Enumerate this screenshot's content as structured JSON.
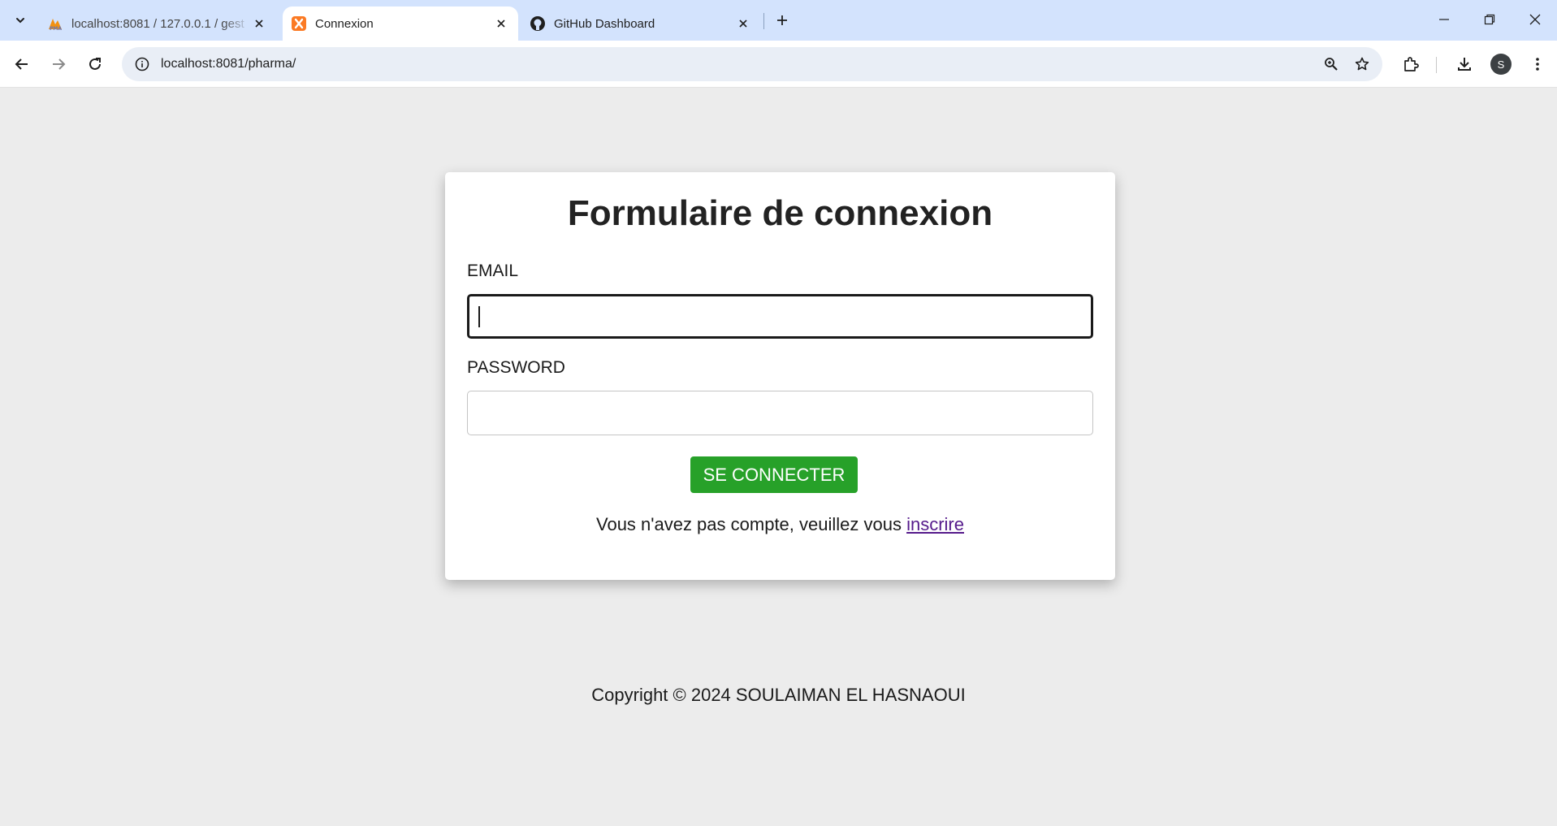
{
  "browser": {
    "tabs": [
      {
        "title": "localhost:8081 / 127.0.0.1 / gest",
        "favicon": "phpmyadmin-icon",
        "active": false
      },
      {
        "title": "Connexion",
        "favicon": "xampp-icon",
        "active": true
      },
      {
        "title": "GitHub Dashboard",
        "favicon": "github-icon",
        "active": false
      }
    ],
    "url": "localhost:8081/pharma/",
    "profile_initial": "S",
    "colors": {
      "tabstrip": "#d3e3fd",
      "omnibox": "#e9eef6"
    }
  },
  "form": {
    "title": "Formulaire de connexion",
    "email_label": "EMAIL",
    "email_value": "",
    "password_label": "PASSWORD",
    "password_value": "",
    "submit_label": "SE CONNECTER",
    "signup_text": "Vous n'avez pas compte, veuillez vous",
    "signup_link": "inscrire"
  },
  "footer": {
    "copyright": "Copyright © 2024 SOULAIMAN EL HASNAOUI"
  },
  "colors": {
    "page_background": "#ececec",
    "submit_button": "#27a129",
    "link_visited": "#551a8b"
  }
}
